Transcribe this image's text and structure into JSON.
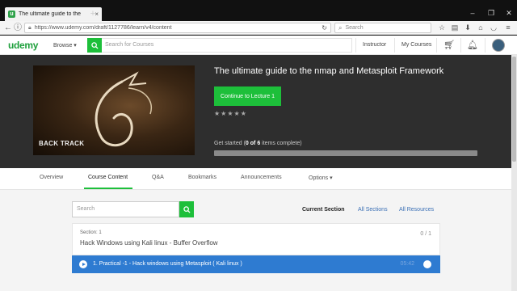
{
  "browser": {
    "tab_title": "The ultimate guide to the",
    "url": "https://www.udemy.com/draft/1127786/learn/v4/content",
    "search_placeholder": "Search"
  },
  "header": {
    "logo": "udemy",
    "browse_label": "Browse ▾",
    "search_placeholder": "Search for Courses",
    "instructor_label": "Instructor",
    "my_courses_label": "My Courses"
  },
  "hero": {
    "image_caption": "BACK TRACK",
    "title": "The ultimate guide to the nmap and Metasploit Framework",
    "continue_label": "Continue to Lecture 1",
    "rating_stars": "★★★★★",
    "progress_prefix": "Get started (",
    "progress_done": "0",
    "progress_of": " of ",
    "progress_total": "6",
    "progress_suffix": " items complete)",
    "progress_fraction": 0
  },
  "tabs": [
    {
      "label": "Overview"
    },
    {
      "label": "Course Content"
    },
    {
      "label": "Q&A"
    },
    {
      "label": "Bookmarks"
    },
    {
      "label": "Announcements"
    },
    {
      "label": "Options ▾"
    }
  ],
  "content": {
    "search_placeholder": "Search",
    "filters": {
      "current": "Current Section",
      "all_sections": "All Sections",
      "all_resources": "All Resources"
    },
    "section": {
      "label": "Section: 1",
      "title": "Hack Windows using Kali linux - Buffer Overflow",
      "count": "0 / 1"
    },
    "lecture": {
      "title": "1.  Practical -1 - Hack windows using Metasploit ( Kali linux )",
      "duration": "05:42"
    }
  },
  "colors": {
    "brand_green": "#1dbf3a",
    "lecture_blue": "#2e7bd1",
    "link_blue": "#3a6fb5"
  }
}
